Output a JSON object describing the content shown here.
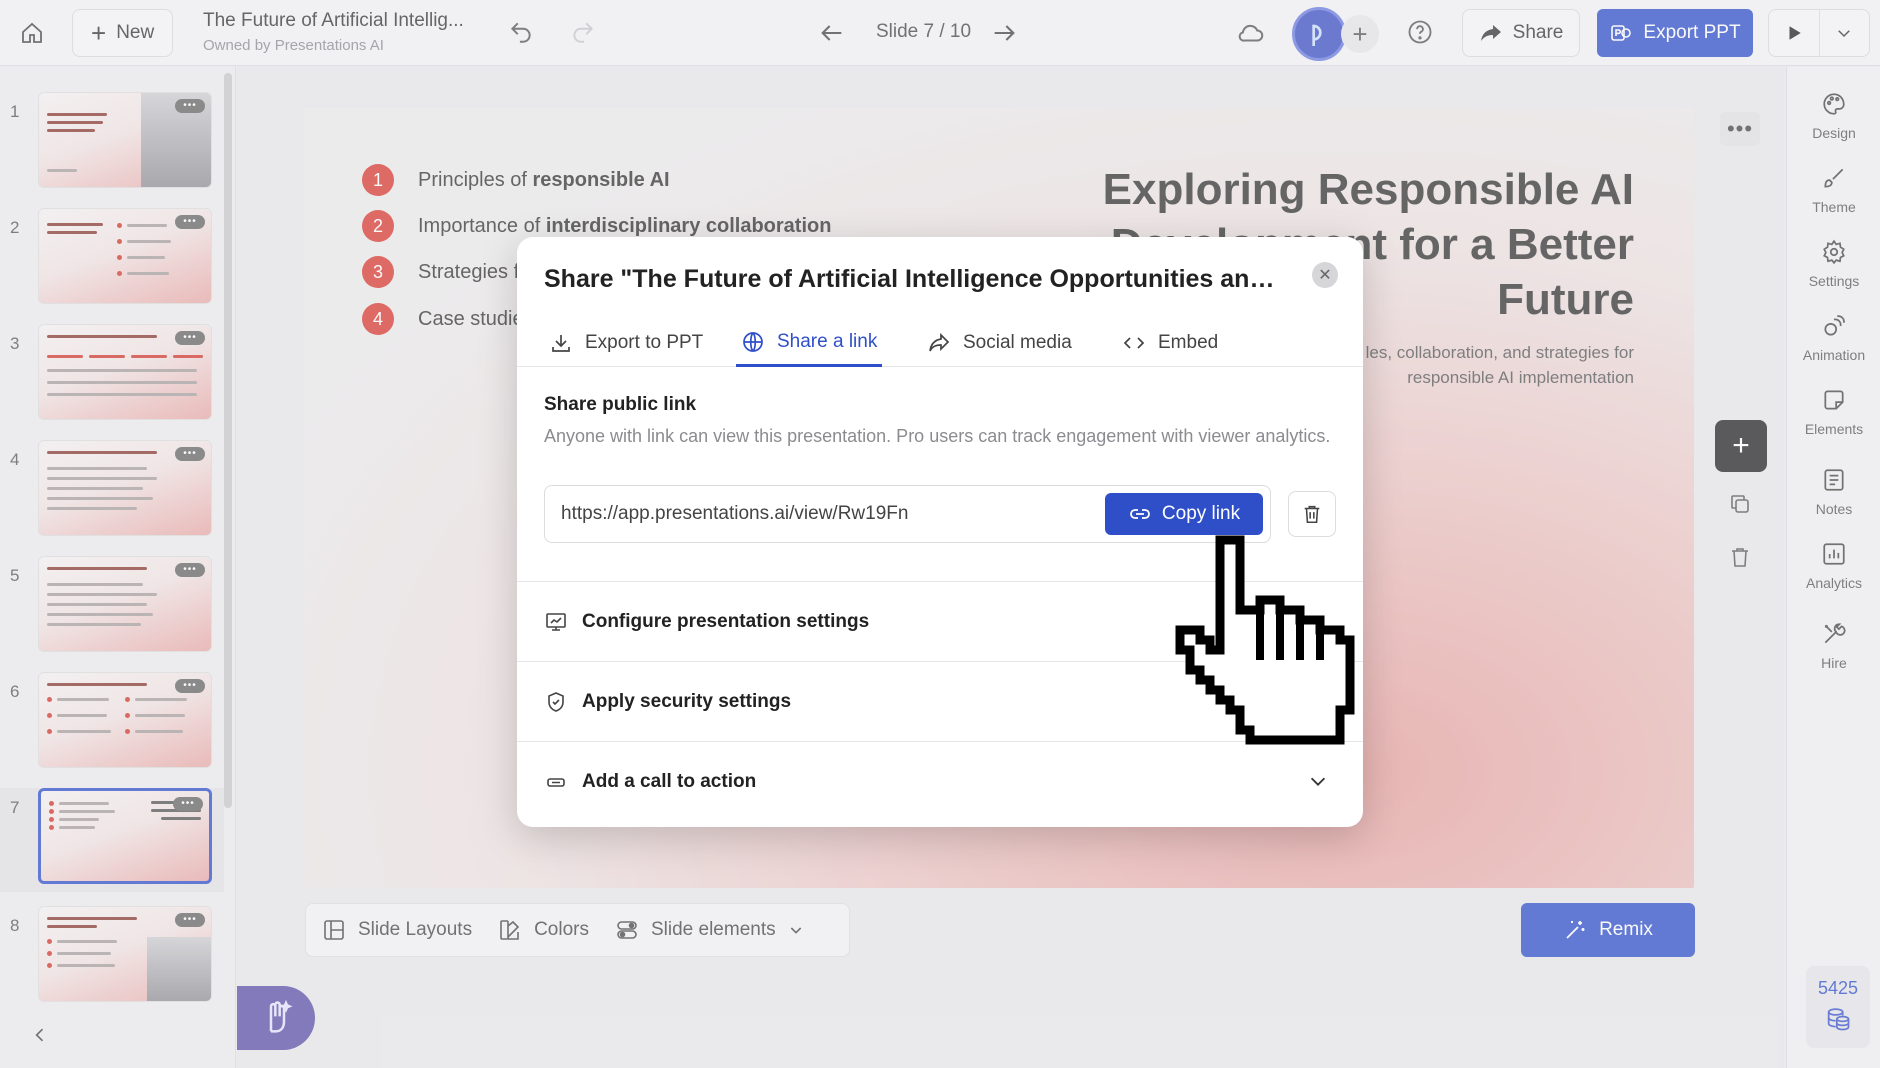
{
  "topbar": {
    "new_label": "New",
    "doc_title": "The Future of Artificial Intellig...",
    "doc_owner": "Owned by Presentations AI",
    "slide_indicator": "Slide 7 / 10",
    "share_label": "Share",
    "export_label": "Export PPT"
  },
  "thumbnails": [
    {
      "num": "1"
    },
    {
      "num": "2"
    },
    {
      "num": "3"
    },
    {
      "num": "4"
    },
    {
      "num": "5"
    },
    {
      "num": "6"
    },
    {
      "num": "7",
      "active": true
    },
    {
      "num": "8"
    }
  ],
  "slide": {
    "bullets": [
      {
        "num": "1",
        "text": "Principles of ",
        "bold": "responsible AI"
      },
      {
        "num": "2",
        "text": "Importance of ",
        "bold": "interdisciplinary collaboration"
      },
      {
        "num": "3",
        "text": "Strategies f",
        "bold": ""
      },
      {
        "num": "4",
        "text": "Case studie",
        "bold": ""
      }
    ],
    "title": "Exploring Responsible AI Development for a Better Future",
    "subtitle": "les, collaboration, and strategies for responsible AI implementation"
  },
  "bottombar": {
    "layouts_label": "Slide Layouts",
    "colors_label": "Colors",
    "elements_label": "Slide elements",
    "remix_label": "Remix"
  },
  "rail": {
    "items": [
      "Design",
      "Theme",
      "Settings",
      "Animation",
      "Elements",
      "Notes",
      "Analytics",
      "Hire"
    ],
    "credits": "5425"
  },
  "modal": {
    "title": "Share \"The Future of Artificial Intelligence Opportunities and ...",
    "tabs": [
      "Export to PPT",
      "Share a link",
      "Social media",
      "Embed"
    ],
    "active_tab": "Share a link",
    "section_title": "Share public link",
    "section_desc": "Anyone with link can view this presentation. Pro users can track engagement with viewer analytics.",
    "url": "https://app.presentations.ai/view/Rw19Fn",
    "copy_label": "Copy link",
    "rows": [
      "Configure presentation settings",
      "Apply security settings",
      "Add a call to action"
    ]
  },
  "colors": {
    "accent": "#2f4fc9",
    "bullet_red": "#d83a30"
  }
}
